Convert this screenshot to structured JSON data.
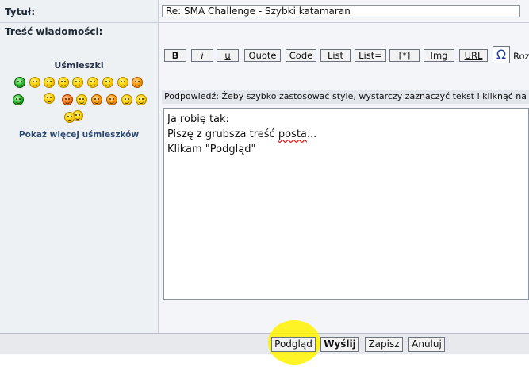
{
  "form": {
    "subject_label": "Tytuł:",
    "subject_value": "Re: SMA Challenge - Szybki katamaran",
    "body_label": "Treść wiadomości:"
  },
  "smileys": {
    "title": "Uśmieszki",
    "more_link": "Pokaż więcej uśmieszków"
  },
  "toolbar": {
    "buttons": [
      "B",
      "i",
      "u",
      "Quote",
      "Code",
      "List",
      "List=",
      "[*]",
      "Img",
      "URL"
    ],
    "omega": "Ω",
    "font_size_label": "Roz"
  },
  "hint": "Podpowiedź: Żeby szybko zastosować style, wystarczy zaznaczyć tekst i kliknąć na",
  "message": {
    "line1": "Ja robię tak:",
    "line2_before": "Piszę z grubsza treść ",
    "line2_misspelled": "posta",
    "line2_after": "...",
    "line3": "Klikam \"Podgląd\""
  },
  "actions": {
    "preview": "Podgląd",
    "send": "Wyślij",
    "save": "Zapisz",
    "cancel": "Anuluj"
  },
  "colors": {
    "highlight": "#fff200",
    "link": "#2c4a75"
  }
}
